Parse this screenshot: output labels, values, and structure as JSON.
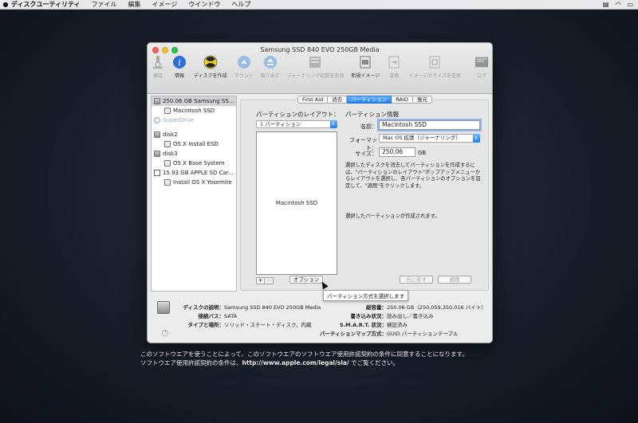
{
  "menubar": {
    "app": "ディスクユーティリティ",
    "items": [
      "ファイル",
      "編集",
      "イメージ",
      "ウインドウ",
      "ヘルプ"
    ]
  },
  "window": {
    "title": "Samsung SSD 840 EVO 250GB Media"
  },
  "toolbar": {
    "items": [
      {
        "label": "検証",
        "icon": "microscope-icon",
        "enabled": false
      },
      {
        "label": "情報",
        "icon": "info-icon",
        "enabled": true
      },
      {
        "label": "ディスクを作成",
        "icon": "burn-icon",
        "enabled": true
      },
      {
        "label": "マウント",
        "icon": "mount-icon",
        "enabled": false
      },
      {
        "label": "取り出す",
        "icon": "eject-icon",
        "enabled": false
      },
      {
        "label": "ジャーナリング記録を有効",
        "icon": "journal-icon",
        "enabled": false
      },
      {
        "label": "新規イメージ",
        "icon": "new-image-icon",
        "enabled": true
      },
      {
        "label": "変換",
        "icon": "convert-icon",
        "enabled": false
      },
      {
        "label": "イメージのサイズを変更",
        "icon": "resize-image-icon",
        "enabled": false
      }
    ],
    "log": "ログ"
  },
  "sidebar": {
    "items": [
      {
        "label": "250.06 GB Samsung SS...",
        "type": "disk",
        "indent": false,
        "selected": true
      },
      {
        "label": "Macintosh SSD",
        "type": "volume",
        "indent": true
      },
      {
        "label": "SuperDrive",
        "type": "optical",
        "indent": false,
        "grey": true
      },
      {
        "label": "disk2",
        "type": "disk",
        "indent": false
      },
      {
        "label": "OS X Install ESD",
        "type": "volume",
        "indent": true
      },
      {
        "label": "disk3",
        "type": "disk",
        "indent": false
      },
      {
        "label": "OS X Base System",
        "type": "volume",
        "indent": true
      },
      {
        "label": "15.93 GB APPLE SD Car...",
        "type": "sd",
        "indent": false
      },
      {
        "label": "Install OS X Yosemite",
        "type": "volume",
        "indent": true
      }
    ]
  },
  "tabs": [
    {
      "label": "First Aid",
      "active": false
    },
    {
      "label": "消去",
      "active": false
    },
    {
      "label": "パーティション",
      "active": true
    },
    {
      "label": "RAID",
      "active": false
    },
    {
      "label": "復元",
      "active": false
    }
  ],
  "partition": {
    "layout_label": "パーティションのレイアウト：",
    "layout_value": "1 パーティション",
    "segment_name": "Macintosh SSD",
    "info_label": "パーティション情報",
    "name_label": "名前：",
    "name_value": "Macintosh SSD",
    "format_label": "フォーマット：",
    "format_value": "Mac OS 拡張（ジャーナリング）",
    "size_label": "サイズ：",
    "size_value": "250.06",
    "size_unit": "GB",
    "help1": "選択したディスクを消去してパーティションを作成するには、\"パーティションのレイアウト\"ポップアップメニューからレイアウトを選択し、各パーティションのオプションを設定して、\"適用\"をクリックします。",
    "help2": "選択したパーティションが作成されます。",
    "plus": "+",
    "minus": "−",
    "options_button": "オプション",
    "revert_button": "元に戻す",
    "apply_button": "適用",
    "tooltip": "パーティション方式を選択します"
  },
  "info": {
    "desc_key": "ディスクの説明：",
    "desc_val": "Samsung SSD 840 EVO 250GB Media",
    "bus_key": "接続バス：",
    "bus_val": "SATA",
    "type_key": "タイプと場所：",
    "type_val": "ソリッド・ステート・ディスク、内蔵",
    "cap_key": "総容量：",
    "cap_val": "250.06 GB（250,059,350,016 バイト）",
    "write_key": "書き込み状況：",
    "write_val": "読み出し／書き込み",
    "smart_key": "S.M.A.R.T. 状況：",
    "smart_val": "検証済み",
    "map_key": "パーティションマップ方式：",
    "map_val": "GUID パーティションテーブル",
    "help": "?"
  },
  "license": {
    "line1": "このソフトウエアを使うことによって、このソフトウエアのソフトウエア使用許諾契約の条件に同意することになります。",
    "line2_pre": "ソフトウエア使用許諾契約の条件は、",
    "url": "http://www.apple.com/legal/sla/",
    "line2_post": " でご覧ください。"
  }
}
